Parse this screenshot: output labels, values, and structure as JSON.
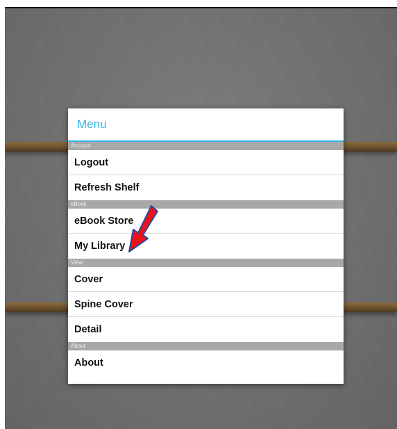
{
  "menu": {
    "title": "Menu",
    "sections": [
      {
        "label": "Account",
        "items": [
          "Logout",
          "Refresh Shelf"
        ]
      },
      {
        "label": "eBook",
        "items": [
          "eBook Store",
          "My Library"
        ]
      },
      {
        "label": "View",
        "items": [
          "Cover",
          "Spine Cover",
          "Detail"
        ]
      },
      {
        "label": "About",
        "items": [
          "About"
        ]
      }
    ]
  },
  "colors": {
    "accent": "#33b5e5",
    "section_bar": "#a8a8a8",
    "annotation_arrow": "#e8141b"
  },
  "icons": {
    "annotation": "red-arrow-icon"
  }
}
